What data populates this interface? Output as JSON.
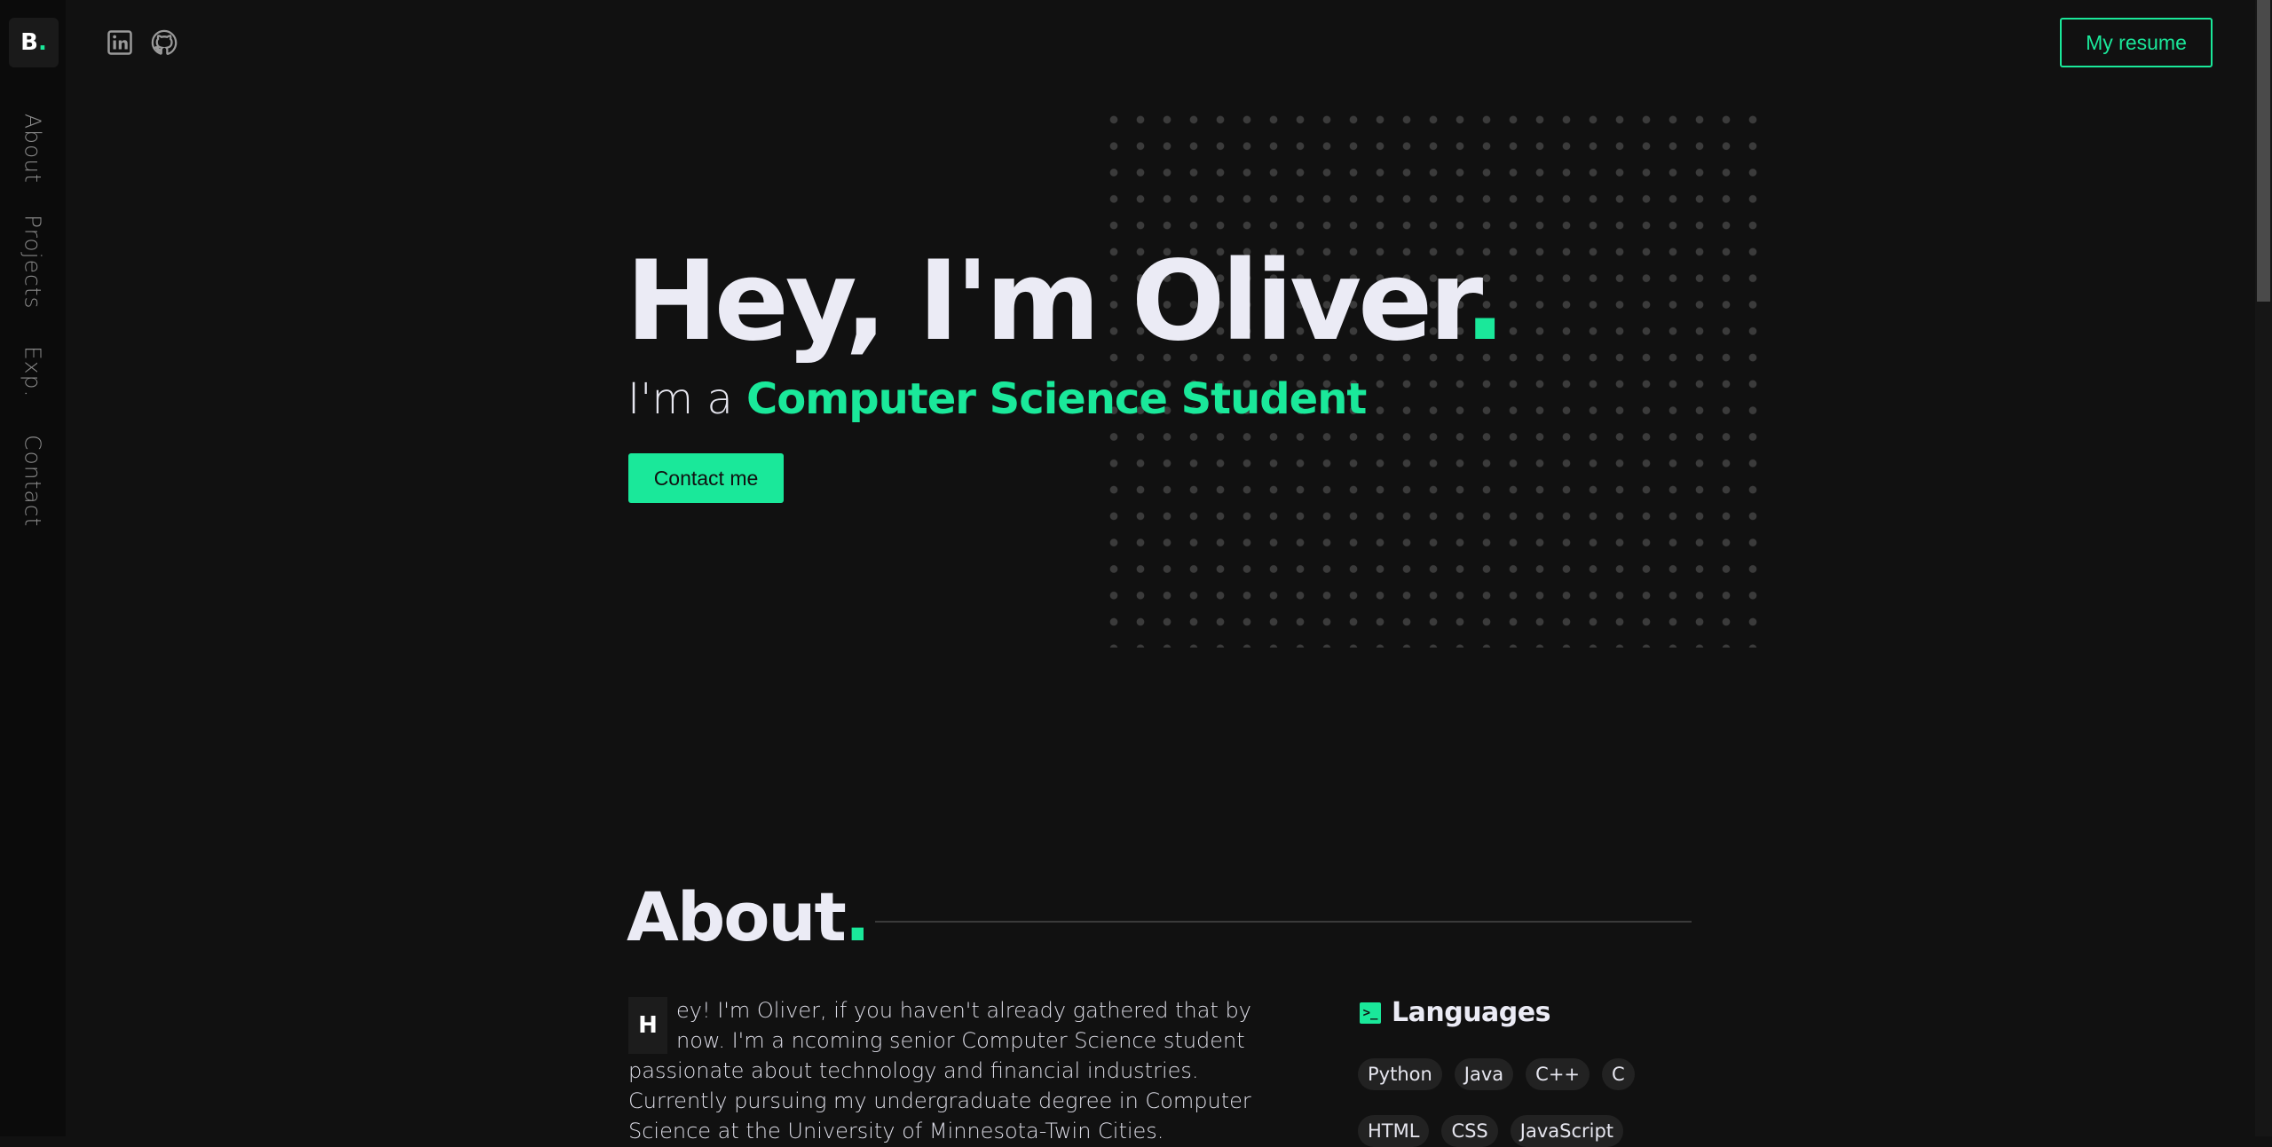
{
  "sidebar": {
    "logo": "B",
    "logo_dot": ".",
    "nav": [
      {
        "label": "About"
      },
      {
        "label": "Projects"
      },
      {
        "label": "Exp."
      },
      {
        "label": "Contact"
      }
    ]
  },
  "header": {
    "icons": [
      "linkedin-icon",
      "github-icon"
    ],
    "resume_label": "My resume"
  },
  "hero": {
    "title": "Hey, I'm Oliver",
    "title_dot": ".",
    "subtitle_prefix": "I'm a ",
    "subtitle_role": "Computer Science Student",
    "contact_label": "Contact me"
  },
  "about": {
    "title": "About",
    "title_dot": ".",
    "dropcap": "H",
    "text": "ey! I'm Oliver, if you haven't already gathered that by now. I'm a ncoming senior Computer Science student passionate about technology and financial industries. Currently pursuing my undergraduate degree in Computer Science at the University of Minnesota-Twin Cities.",
    "languages_title": "Languages",
    "languages_row1": [
      "Python",
      "Java",
      "C++",
      "C"
    ],
    "languages_row2": [
      "HTML",
      "CSS",
      "JavaScript"
    ]
  },
  "colors": {
    "accent": "#1ae89a",
    "background": "#111111",
    "sidebar": "#0b0b0b"
  }
}
